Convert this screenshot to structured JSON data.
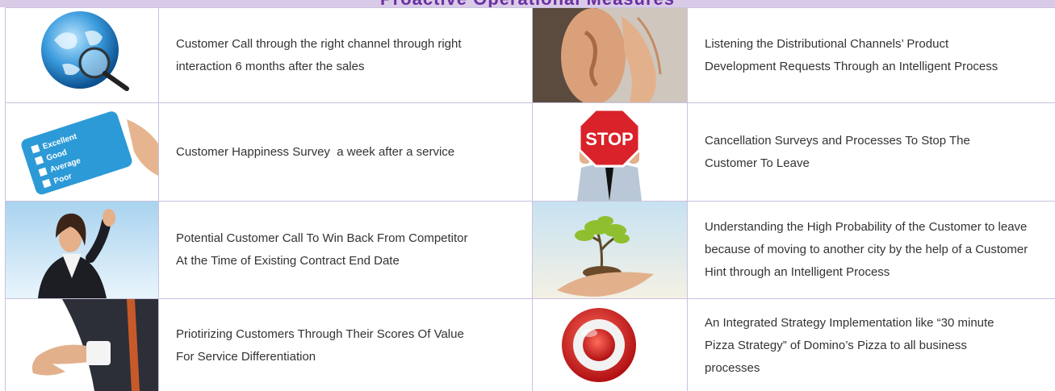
{
  "header": {
    "title": "Proactive Operational Measures"
  },
  "rows": [
    {
      "left": {
        "image": "globe-magnifier-icon",
        "lines": [
          "Customer Call through the right channel through right",
          "interaction 6 months after the sales"
        ]
      },
      "right": {
        "image": "listening-ear-icon",
        "lines": [
          "Listening the Distributional Channels’ Product",
          "Development Requests Through an Intelligent Process"
        ]
      }
    },
    {
      "left": {
        "image": "survey-card-icon",
        "lines": [
          "Customer Happiness Survey  a week after a service"
        ],
        "card": [
          "Excellent",
          "Good",
          "Average",
          "Poor"
        ]
      },
      "right": {
        "image": "stop-sign-icon",
        "lines": [
          "Cancellation Surveys and Processes To Stop The",
          "Customer To Leave"
        ],
        "sign": "STOP"
      }
    },
    {
      "left": {
        "image": "waving-woman-icon",
        "lines": [
          "Potential Customer Call To Win Back From Competitor",
          "At the Time of Existing Contract End Date"
        ]
      },
      "right": {
        "image": "plant-in-hands-icon",
        "lines": [
          "Understanding the High Probability of the Customer to leave",
          "because of moving to another city by the help of a Customer",
          "Hint through an Intelligent Process"
        ]
      }
    },
    {
      "left": {
        "image": "handshake-icon",
        "lines": [
          "Priotirizing Customers Through Their Scores Of Value",
          "For Service Differentiation"
        ]
      },
      "right": {
        "image": "target-icon",
        "lines": [
          "An Integrated Strategy Implementation like “30 minute",
          "Pizza Strategy” of Domino’s Pizza to all business",
          "processes"
        ]
      }
    }
  ]
}
